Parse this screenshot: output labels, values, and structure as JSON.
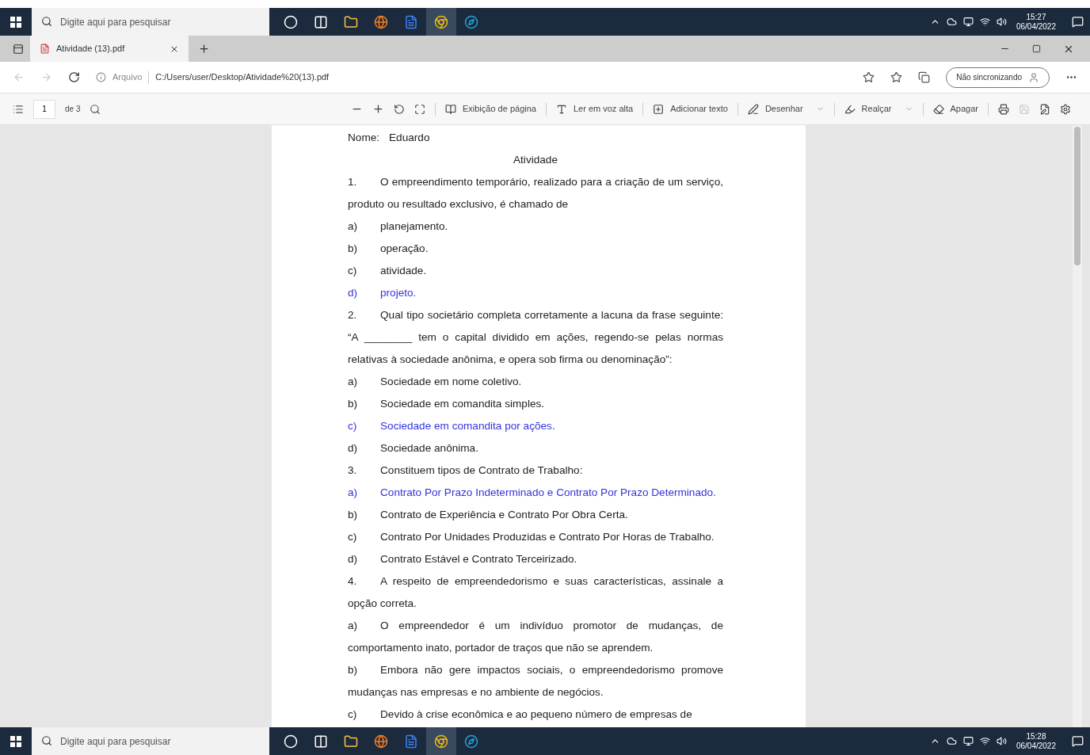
{
  "taskbar_top": {
    "search_placeholder": "Digite aqui para pesquisar",
    "time": "15:27",
    "date": "06/04/2022"
  },
  "browser": {
    "tab": {
      "title": "Atividade (13).pdf"
    },
    "address": {
      "scheme_label": "Arquivo",
      "url": "C:/Users/user/Desktop/Atividade%20(13).pdf"
    },
    "profile_label": "Não sincronizando"
  },
  "pdf_toolbar": {
    "page": "1",
    "page_count": "de 3",
    "tools": [
      {
        "label": "Exibição de página",
        "dropdown": false
      },
      {
        "label": "Ler em voz alta",
        "dropdown": false
      },
      {
        "label": "Adicionar texto",
        "dropdown": false
      },
      {
        "label": "Desenhar",
        "dropdown": true
      },
      {
        "label": "Realçar",
        "dropdown": true
      },
      {
        "label": "Apagar",
        "dropdown": false
      }
    ]
  },
  "document": {
    "lines": [
      {
        "kind": "name",
        "label": "Nome:",
        "value": "Eduardo"
      },
      {
        "kind": "title",
        "text": "Atividade"
      },
      {
        "kind": "question",
        "marker": "1.",
        "text": "O empreendimento temporário, realizado para a criação de um serviço, produto ou resultado exclusivo, é chamado de"
      },
      {
        "kind": "option",
        "marker": "a)",
        "text": "planejamento.",
        "selected": false
      },
      {
        "kind": "option",
        "marker": "b)",
        "text": "operação.",
        "selected": false
      },
      {
        "kind": "option",
        "marker": "c)",
        "text": "atividade.",
        "selected": false
      },
      {
        "kind": "option",
        "marker": "d)",
        "text": "projeto.",
        "selected": true
      },
      {
        "kind": "question",
        "marker": "2.",
        "text": "Qual tipo societário completa corretamente a lacuna da frase seguinte: “A ________ tem o capital dividido em ações, regendo-se pelas normas relativas à sociedade anônima, e opera sob firma ou denominação”:"
      },
      {
        "kind": "option",
        "marker": "a)",
        "text": "Sociedade em nome coletivo.",
        "selected": false
      },
      {
        "kind": "option",
        "marker": "b)",
        "text": "Sociedade em comandita simples.",
        "selected": false
      },
      {
        "kind": "option",
        "marker": "c)",
        "text": "Sociedade em comandita por ações.",
        "selected": true
      },
      {
        "kind": "option",
        "marker": "d)",
        "text": "Sociedade anônima.",
        "selected": false
      },
      {
        "kind": "question",
        "marker": "3.",
        "text": "Constituem tipos de Contrato de Trabalho:"
      },
      {
        "kind": "option",
        "marker": "a)",
        "text": "Contrato Por Prazo Indeterminado e Contrato Por Prazo Determinado.",
        "selected": true
      },
      {
        "kind": "option",
        "marker": "b)",
        "text": "Contrato de Experiência e Contrato Por Obra Certa.",
        "selected": false
      },
      {
        "kind": "option",
        "marker": "c)",
        "text": "Contrato Por Unidades Produzidas e Contrato Por Horas de Trabalho.",
        "selected": false
      },
      {
        "kind": "option",
        "marker": "d)",
        "text": "Contrato Estável e Contrato Terceirizado.",
        "selected": false
      },
      {
        "kind": "question",
        "marker": "4.",
        "text": "A respeito de empreendedorismo e suas características, assinale a opção correta."
      },
      {
        "kind": "option",
        "marker": "a)",
        "text": "O empreendedor é um indivíduo promotor de mudanças, de comportamento inato, portador de traços que não se aprendem.",
        "selected": false
      },
      {
        "kind": "option",
        "marker": "b)",
        "text": "Embora não gere impactos sociais, o empreendedorismo promove mudanças nas empresas e no ambiente de negócios.",
        "selected": false
      },
      {
        "kind": "option",
        "marker": "c)",
        "text": "Devido à crise econômica e ao pequeno número de empresas de",
        "selected": false
      }
    ]
  },
  "taskbar_bottom": {
    "search_placeholder": "Digite aqui para pesquisar",
    "time": "15:28",
    "date": "06/04/2022"
  }
}
